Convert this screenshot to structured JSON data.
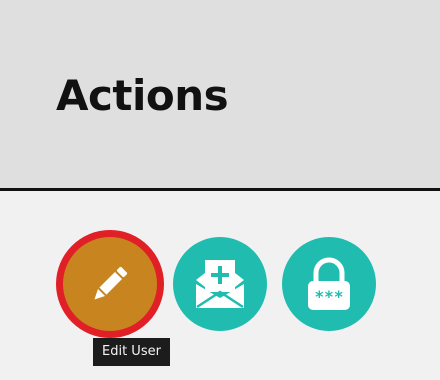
{
  "header": {
    "title": "Actions"
  },
  "actions": [
    {
      "name": "edit-user",
      "icon": "pencil-icon",
      "color": "#c8851f",
      "ring_color": "#e01f26",
      "selected": true
    },
    {
      "name": "invite-user",
      "icon": "envelope-plus-icon",
      "color": "#1fbcaf",
      "selected": false
    },
    {
      "name": "reset-password",
      "icon": "padlock-icon",
      "color": "#1fbcaf",
      "selected": false
    }
  ],
  "tooltip": {
    "text": "Edit User"
  }
}
